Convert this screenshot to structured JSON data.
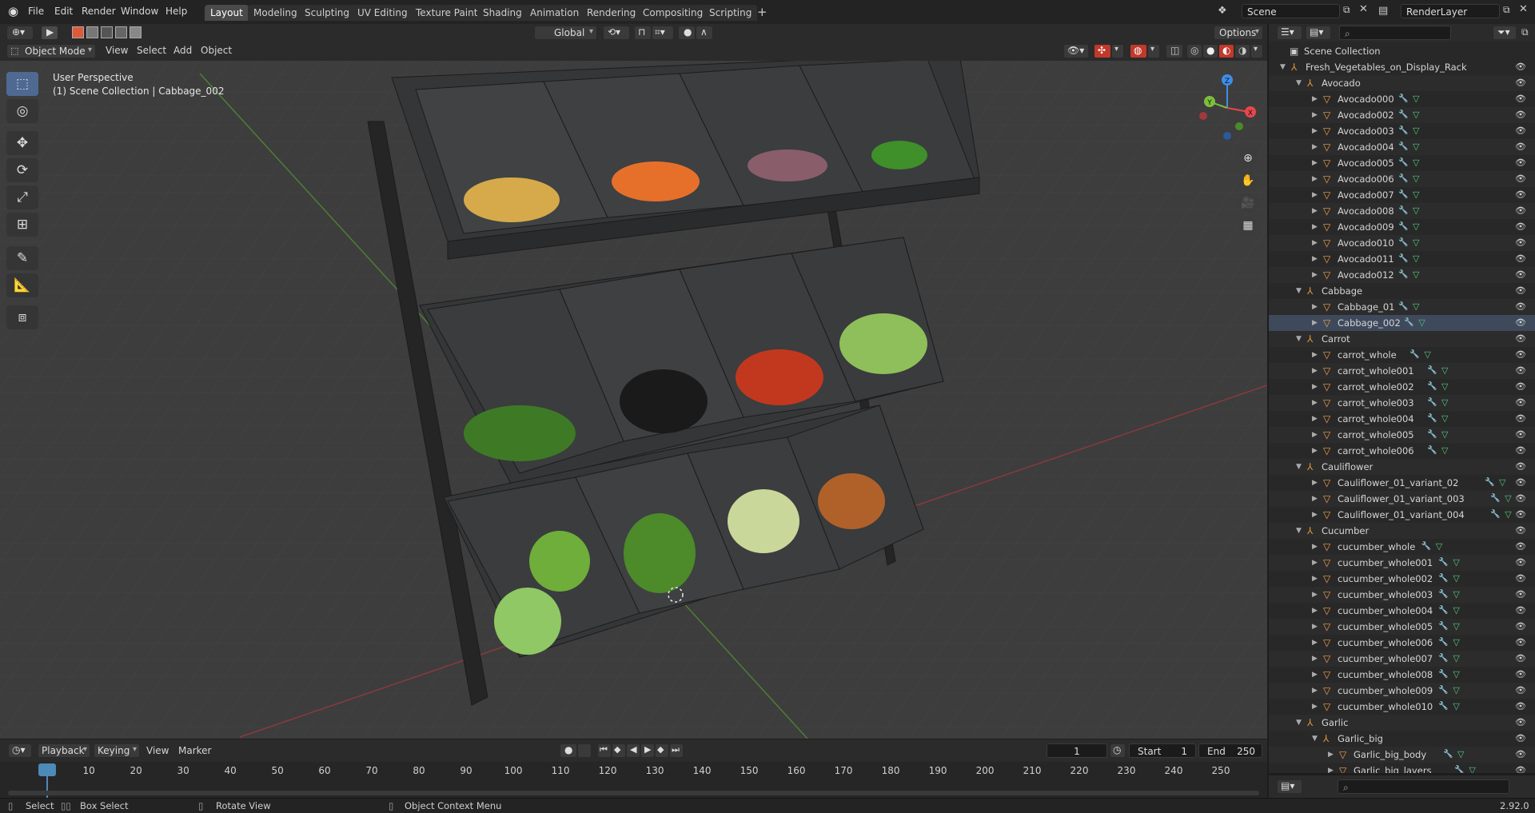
{
  "topbar": {
    "menus": [
      "File",
      "Edit",
      "Render",
      "Window",
      "Help"
    ],
    "workspaces": [
      "Layout",
      "Modeling",
      "Sculpting",
      "UV Editing",
      "Texture Paint",
      "Shading",
      "Animation",
      "Rendering",
      "Compositing",
      "Scripting"
    ],
    "active_workspace": "Layout",
    "add_tab": "+",
    "scene": "Scene",
    "render_layer": "RenderLayer"
  },
  "viewport_header": {
    "mode": "Object Mode",
    "menus": [
      "View",
      "Select",
      "Add",
      "Object"
    ],
    "transform_orientation": "Global",
    "options": "Options"
  },
  "viewport": {
    "perspective": "User Perspective",
    "collection_info": "(1) Scene Collection | Cabbage_002",
    "axes": [
      "X",
      "Y",
      "Z"
    ],
    "colors": {
      "x": "#e8474c",
      "y": "#7cbf3a",
      "z": "#3e8ee6",
      "grid": "#484848"
    }
  },
  "toolbar": {
    "tools": [
      "select-box",
      "cursor",
      "move",
      "rotate",
      "scale",
      "transform",
      "annotate",
      "measure",
      "add-cube"
    ]
  },
  "outliner": {
    "search_placeholder": "",
    "root": "Scene Collection",
    "rows": [
      {
        "label": "Fresh_Vegetables_on_Display_Rack",
        "type": "collection",
        "depth": 0
      },
      {
        "label": "Avocado",
        "type": "collection",
        "depth": 1
      },
      {
        "label": "Avocado000",
        "type": "object",
        "depth": 2
      },
      {
        "label": "Avocado002",
        "type": "object",
        "depth": 2
      },
      {
        "label": "Avocado003",
        "type": "object",
        "depth": 2
      },
      {
        "label": "Avocado004",
        "type": "object",
        "depth": 2
      },
      {
        "label": "Avocado005",
        "type": "object",
        "depth": 2
      },
      {
        "label": "Avocado006",
        "type": "object",
        "depth": 2
      },
      {
        "label": "Avocado007",
        "type": "object",
        "depth": 2
      },
      {
        "label": "Avocado008",
        "type": "object",
        "depth": 2
      },
      {
        "label": "Avocado009",
        "type": "object",
        "depth": 2
      },
      {
        "label": "Avocado010",
        "type": "object",
        "depth": 2
      },
      {
        "label": "Avocado011",
        "type": "object",
        "depth": 2
      },
      {
        "label": "Avocado012",
        "type": "object",
        "depth": 2
      },
      {
        "label": "Cabbage",
        "type": "collection",
        "depth": 1
      },
      {
        "label": "Cabbage_01",
        "type": "object",
        "depth": 2
      },
      {
        "label": "Cabbage_002",
        "type": "object",
        "depth": 2,
        "selected": true
      },
      {
        "label": "Carrot",
        "type": "collection",
        "depth": 1
      },
      {
        "label": "carrot_whole",
        "type": "object",
        "depth": 2
      },
      {
        "label": "carrot_whole001",
        "type": "object",
        "depth": 2
      },
      {
        "label": "carrot_whole002",
        "type": "object",
        "depth": 2
      },
      {
        "label": "carrot_whole003",
        "type": "object",
        "depth": 2
      },
      {
        "label": "carrot_whole004",
        "type": "object",
        "depth": 2
      },
      {
        "label": "carrot_whole005",
        "type": "object",
        "depth": 2
      },
      {
        "label": "carrot_whole006",
        "type": "object",
        "depth": 2
      },
      {
        "label": "Cauliflower",
        "type": "collection",
        "depth": 1
      },
      {
        "label": "Cauliflower_01_variant_02",
        "type": "object",
        "depth": 2
      },
      {
        "label": "Cauliflower_01_variant_003",
        "type": "object",
        "depth": 2
      },
      {
        "label": "Cauliflower_01_variant_004",
        "type": "object",
        "depth": 2
      },
      {
        "label": "Cucumber",
        "type": "collection",
        "depth": 1
      },
      {
        "label": "cucumber_whole",
        "type": "object",
        "depth": 2
      },
      {
        "label": "cucumber_whole001",
        "type": "object",
        "depth": 2
      },
      {
        "label": "cucumber_whole002",
        "type": "object",
        "depth": 2
      },
      {
        "label": "cucumber_whole003",
        "type": "object",
        "depth": 2
      },
      {
        "label": "cucumber_whole004",
        "type": "object",
        "depth": 2
      },
      {
        "label": "cucumber_whole005",
        "type": "object",
        "depth": 2
      },
      {
        "label": "cucumber_whole006",
        "type": "object",
        "depth": 2
      },
      {
        "label": "cucumber_whole007",
        "type": "object",
        "depth": 2
      },
      {
        "label": "cucumber_whole008",
        "type": "object",
        "depth": 2
      },
      {
        "label": "cucumber_whole009",
        "type": "object",
        "depth": 2
      },
      {
        "label": "cucumber_whole010",
        "type": "object",
        "depth": 2
      },
      {
        "label": "Garlic",
        "type": "collection",
        "depth": 1
      },
      {
        "label": "Garlic_big",
        "type": "collection",
        "depth": 2
      },
      {
        "label": "Garlic_big_body",
        "type": "object",
        "depth": 3
      },
      {
        "label": "Garlic_big_layers",
        "type": "object",
        "depth": 3
      }
    ]
  },
  "timeline": {
    "menus": [
      "Playback",
      "Keying",
      "View",
      "Marker"
    ],
    "current_frame": "1",
    "start_label": "Start",
    "start": "1",
    "end_label": "End",
    "end": "250",
    "ticks": [
      "1",
      "10",
      "20",
      "30",
      "40",
      "50",
      "60",
      "70",
      "80",
      "90",
      "100",
      "110",
      "120",
      "130",
      "140",
      "150",
      "160",
      "170",
      "180",
      "190",
      "200",
      "210",
      "220",
      "230",
      "240",
      "250"
    ]
  },
  "statusbar": {
    "hints": [
      "Select",
      "Box Select",
      "Rotate View",
      "Object Context Menu"
    ],
    "version": "2.92.0"
  }
}
